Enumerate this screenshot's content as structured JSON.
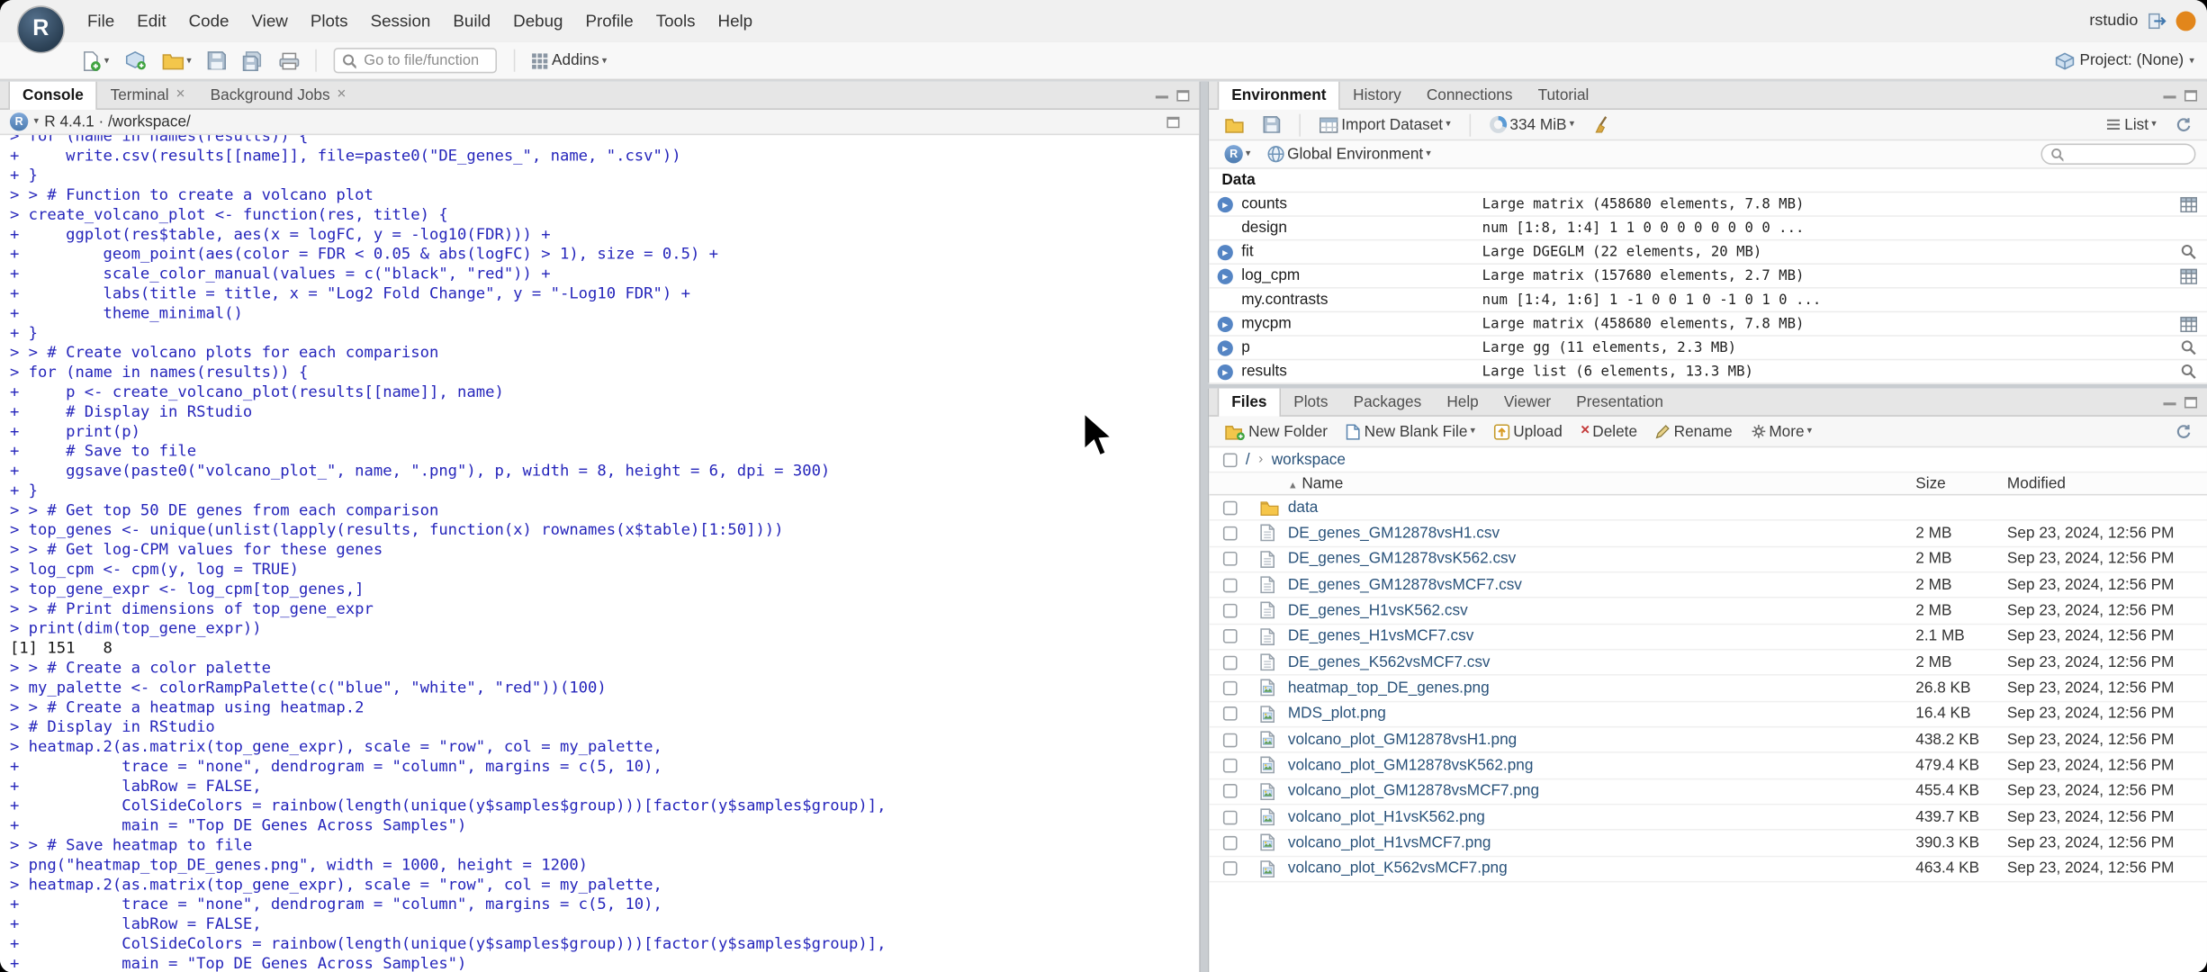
{
  "icons": {
    "chevron_down": "▾",
    "close": "×",
    "sort_asc": "▲",
    "expand": "▸",
    "delete_x": "×"
  },
  "menubar": {
    "logo_letter": "R",
    "items": [
      "File",
      "Edit",
      "Code",
      "View",
      "Plots",
      "Session",
      "Build",
      "Debug",
      "Profile",
      "Tools",
      "Help"
    ],
    "user": "rstudio"
  },
  "toolbar": {
    "goto_placeholder": "Go to file/function",
    "addins_label": "Addins",
    "project_label": "Project: (None)"
  },
  "console_pane": {
    "tabs": [
      {
        "label": "Console",
        "active": true,
        "closable": false
      },
      {
        "label": "Terminal",
        "active": false,
        "closable": true
      },
      {
        "label": "Background Jobs",
        "active": false,
        "closable": true
      }
    ],
    "version_label": "R 4.4.1 · /workspace/",
    "lines": [
      {
        "type": "input",
        "text": "> for (name in names(results)) {"
      },
      {
        "type": "input",
        "text": "+     write.csv(results[[name]], file=paste0(\"DE_genes_\", name, \".csv\"))"
      },
      {
        "type": "input",
        "text": "+ }"
      },
      {
        "type": "input",
        "text": "> > # Function to create a volcano plot"
      },
      {
        "type": "input",
        "text": "> create_volcano_plot <- function(res, title) {"
      },
      {
        "type": "input",
        "text": "+     ggplot(res$table, aes(x = logFC, y = -log10(FDR))) +"
      },
      {
        "type": "input",
        "text": "+         geom_point(aes(color = FDR < 0.05 & abs(logFC) > 1), size = 0.5) +"
      },
      {
        "type": "input",
        "text": "+         scale_color_manual(values = c(\"black\", \"red\")) +"
      },
      {
        "type": "input",
        "text": "+         labs(title = title, x = \"Log2 Fold Change\", y = \"-Log10 FDR\") +"
      },
      {
        "type": "input",
        "text": "+         theme_minimal()"
      },
      {
        "type": "input",
        "text": "+ }"
      },
      {
        "type": "input",
        "text": "> > # Create volcano plots for each comparison"
      },
      {
        "type": "input",
        "text": "> for (name in names(results)) {"
      },
      {
        "type": "input",
        "text": "+     p <- create_volcano_plot(results[[name]], name)"
      },
      {
        "type": "input",
        "text": "+     # Display in RStudio"
      },
      {
        "type": "input",
        "text": "+     print(p)"
      },
      {
        "type": "input",
        "text": "+     # Save to file"
      },
      {
        "type": "input",
        "text": "+     ggsave(paste0(\"volcano_plot_\", name, \".png\"), p, width = 8, height = 6, dpi = 300)"
      },
      {
        "type": "input",
        "text": "+ }"
      },
      {
        "type": "input",
        "text": "> > # Get top 50 DE genes from each comparison"
      },
      {
        "type": "input",
        "text": "> top_genes <- unique(unlist(lapply(results, function(x) rownames(x$table)[1:50])))"
      },
      {
        "type": "input",
        "text": "> > # Get log-CPM values for these genes"
      },
      {
        "type": "input",
        "text": "> log_cpm <- cpm(y, log = TRUE)"
      },
      {
        "type": "input",
        "text": "> top_gene_expr <- log_cpm[top_genes,]"
      },
      {
        "type": "input",
        "text": "> > # Print dimensions of top_gene_expr"
      },
      {
        "type": "input",
        "text": "> print(dim(top_gene_expr))"
      },
      {
        "type": "output",
        "text": "[1] 151   8"
      },
      {
        "type": "input",
        "text": "> > # Create a color palette"
      },
      {
        "type": "input",
        "text": "> my_palette <- colorRampPalette(c(\"blue\", \"white\", \"red\"))(100)"
      },
      {
        "type": "input",
        "text": "> > # Create a heatmap using heatmap.2"
      },
      {
        "type": "input",
        "text": "> # Display in RStudio"
      },
      {
        "type": "input",
        "text": "> heatmap.2(as.matrix(top_gene_expr), scale = \"row\", col = my_palette,"
      },
      {
        "type": "input",
        "text": "+           trace = \"none\", dendrogram = \"column\", margins = c(5, 10),"
      },
      {
        "type": "input",
        "text": "+           labRow = FALSE,"
      },
      {
        "type": "input",
        "text": "+           ColSideColors = rainbow(length(unique(y$samples$group)))[factor(y$samples$group)],"
      },
      {
        "type": "input",
        "text": "+           main = \"Top DE Genes Across Samples\")"
      },
      {
        "type": "input",
        "text": "> > # Save heatmap to file"
      },
      {
        "type": "input",
        "text": "> png(\"heatmap_top_DE_genes.png\", width = 1000, height = 1200)"
      },
      {
        "type": "input",
        "text": "> heatmap.2(as.matrix(top_gene_expr), scale = \"row\", col = my_palette,"
      },
      {
        "type": "input",
        "text": "+           trace = \"none\", dendrogram = \"column\", margins = c(5, 10),"
      },
      {
        "type": "input",
        "text": "+           labRow = FALSE,"
      },
      {
        "type": "input",
        "text": "+           ColSideColors = rainbow(length(unique(y$samples$group)))[factor(y$samples$group)],"
      },
      {
        "type": "input",
        "text": "+           main = \"Top DE Genes Across Samples\")"
      }
    ]
  },
  "environment_pane": {
    "tabs": [
      {
        "label": "Environment",
        "active": true,
        "closable": false
      },
      {
        "label": "History",
        "active": false,
        "closable": false
      },
      {
        "label": "Connections",
        "active": false,
        "closable": false
      },
      {
        "label": "Tutorial",
        "active": false,
        "closable": false
      }
    ],
    "toolbar": {
      "import_label": "Import Dataset",
      "memory_label": "334 MiB",
      "list_label": "List"
    },
    "scope_row": {
      "language": "R",
      "scope": "Global Environment"
    },
    "section_label": "Data",
    "objects": [
      {
        "name": "counts",
        "value": "Large matrix (458680 elements, 7.8 MB)",
        "expandable": true,
        "action": "grid"
      },
      {
        "name": "design",
        "value": "num [1:8, 1:4] 1 1 0 0 0 0 0 0 0 0 ...",
        "expandable": false,
        "action": ""
      },
      {
        "name": "fit",
        "value": "Large DGEGLM (22 elements, 20 MB)",
        "expandable": true,
        "action": "search"
      },
      {
        "name": "log_cpm",
        "value": "Large matrix (157680 elements, 2.7 MB)",
        "expandable": true,
        "action": "grid"
      },
      {
        "name": "my.contrasts",
        "value": "num [1:4, 1:6] 1 -1 0 0 1 0 -1 0 1 0 ...",
        "expandable": false,
        "action": ""
      },
      {
        "name": "mycpm",
        "value": "Large matrix (458680 elements, 7.8 MB)",
        "expandable": true,
        "action": "grid"
      },
      {
        "name": "p",
        "value": "Large gg (11 elements, 2.3 MB)",
        "expandable": true,
        "action": "search"
      },
      {
        "name": "results",
        "value": "Large list (6 elements, 13.3 MB)",
        "expandable": true,
        "action": "search"
      }
    ]
  },
  "files_pane": {
    "tabs": [
      {
        "label": "Files",
        "active": true,
        "closable": false
      },
      {
        "label": "Plots",
        "active": false,
        "closable": false
      },
      {
        "label": "Packages",
        "active": false,
        "closable": false
      },
      {
        "label": "Help",
        "active": false,
        "closable": false
      },
      {
        "label": "Viewer",
        "active": false,
        "closable": false
      },
      {
        "label": "Presentation",
        "active": false,
        "closable": false
      }
    ],
    "toolbar": {
      "new_folder": "New Folder",
      "new_blank_file": "New Blank File",
      "upload": "Upload",
      "delete": "Delete",
      "rename": "Rename",
      "more": "More"
    },
    "breadcrumb": {
      "root": "/",
      "separator": "›",
      "folder": "workspace"
    },
    "columns": {
      "name": "Name",
      "size": "Size",
      "modified": "Modified"
    },
    "rows": [
      {
        "type": "folder",
        "name": "data",
        "size": "",
        "modified": ""
      },
      {
        "type": "csv",
        "name": "DE_genes_GM12878vsH1.csv",
        "size": "2 MB",
        "modified": "Sep 23, 2024, 12:56 PM"
      },
      {
        "type": "csv",
        "name": "DE_genes_GM12878vsK562.csv",
        "size": "2 MB",
        "modified": "Sep 23, 2024, 12:56 PM"
      },
      {
        "type": "csv",
        "name": "DE_genes_GM12878vsMCF7.csv",
        "size": "2 MB",
        "modified": "Sep 23, 2024, 12:56 PM"
      },
      {
        "type": "csv",
        "name": "DE_genes_H1vsK562.csv",
        "size": "2 MB",
        "modified": "Sep 23, 2024, 12:56 PM"
      },
      {
        "type": "csv",
        "name": "DE_genes_H1vsMCF7.csv",
        "size": "2.1 MB",
        "modified": "Sep 23, 2024, 12:56 PM"
      },
      {
        "type": "csv",
        "name": "DE_genes_K562vsMCF7.csv",
        "size": "2 MB",
        "modified": "Sep 23, 2024, 12:56 PM"
      },
      {
        "type": "image",
        "name": "heatmap_top_DE_genes.png",
        "size": "26.8 KB",
        "modified": "Sep 23, 2024, 12:56 PM"
      },
      {
        "type": "image",
        "name": "MDS_plot.png",
        "size": "16.4 KB",
        "modified": "Sep 23, 2024, 12:56 PM"
      },
      {
        "type": "image",
        "name": "volcano_plot_GM12878vsH1.png",
        "size": "438.2 KB",
        "modified": "Sep 23, 2024, 12:56 PM"
      },
      {
        "type": "image",
        "name": "volcano_plot_GM12878vsK562.png",
        "size": "479.4 KB",
        "modified": "Sep 23, 2024, 12:56 PM"
      },
      {
        "type": "image",
        "name": "volcano_plot_GM12878vsMCF7.png",
        "size": "455.4 KB",
        "modified": "Sep 23, 2024, 12:56 PM"
      },
      {
        "type": "image",
        "name": "volcano_plot_H1vsK562.png",
        "size": "439.7 KB",
        "modified": "Sep 23, 2024, 12:56 PM"
      },
      {
        "type": "image",
        "name": "volcano_plot_H1vsMCF7.png",
        "size": "390.3 KB",
        "modified": "Sep 23, 2024, 12:56 PM"
      },
      {
        "type": "image",
        "name": "volcano_plot_K562vsMCF7.png",
        "size": "463.4 KB",
        "modified": "Sep 23, 2024, 12:56 PM"
      }
    ]
  }
}
